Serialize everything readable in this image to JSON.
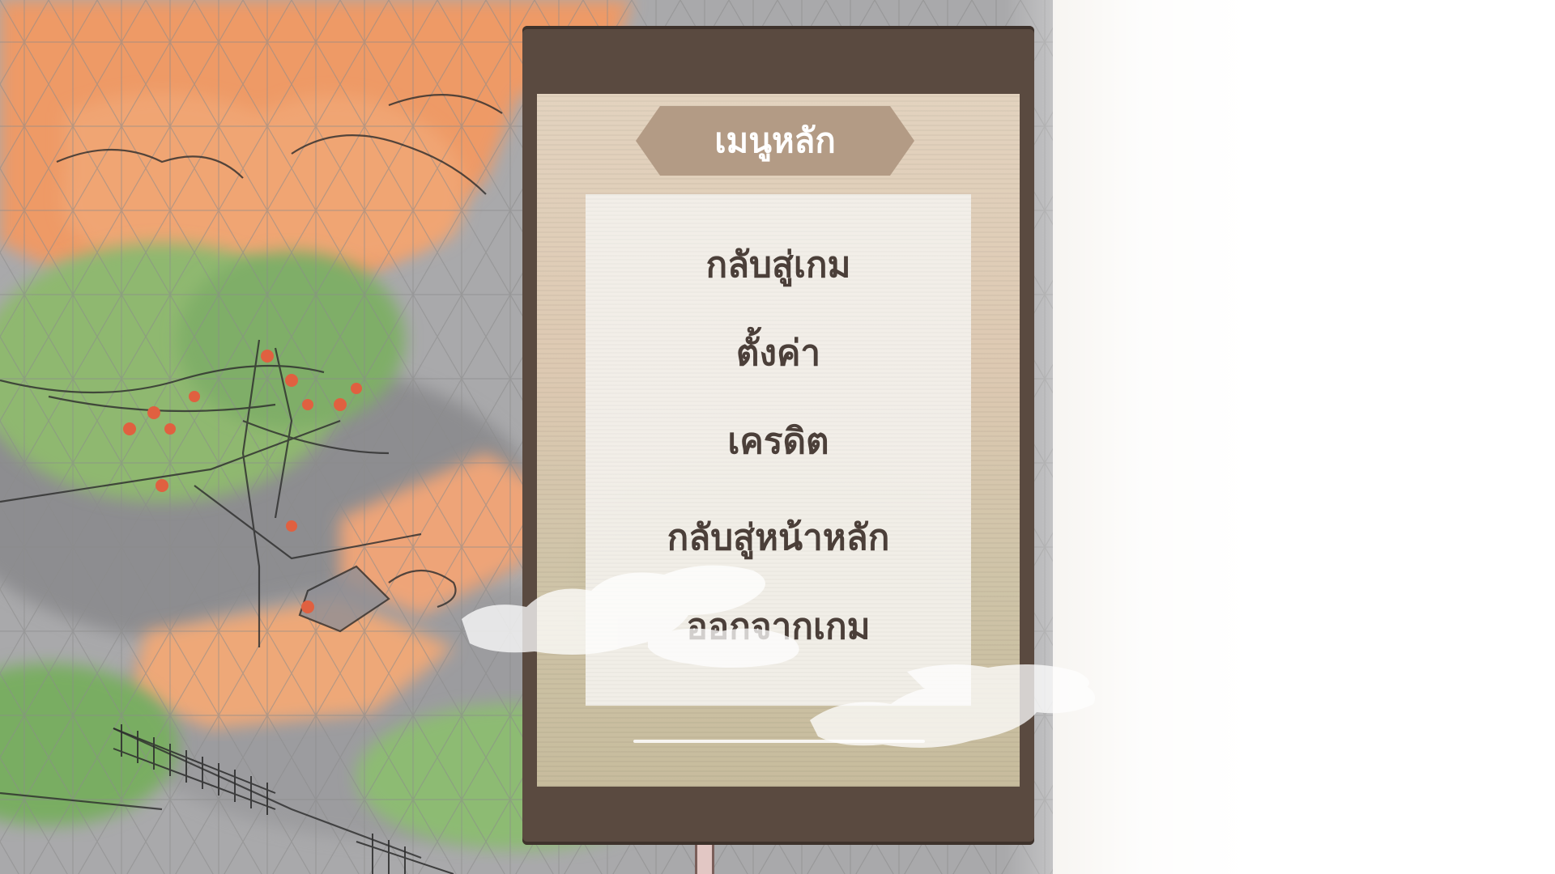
{
  "menu": {
    "title": "เมนูหลัก",
    "items": [
      {
        "id": "resume",
        "label": "กลับสู่เกม"
      },
      {
        "id": "settings",
        "label": "ตั้งค่า"
      },
      {
        "id": "credits",
        "label": "เครดิต"
      },
      {
        "id": "main-menu",
        "label": "กลับสู่หน้าหลัก"
      },
      {
        "id": "quit",
        "label": "ออกจากเกม"
      }
    ]
  },
  "colors": {
    "panel_frame": "#5a4a40",
    "banner": "#b39b85",
    "menu_text": "#4b3f39",
    "title_text": "#ffffff",
    "foliage_orange": "#ee9a66",
    "foliage_green": "#8fb870"
  }
}
